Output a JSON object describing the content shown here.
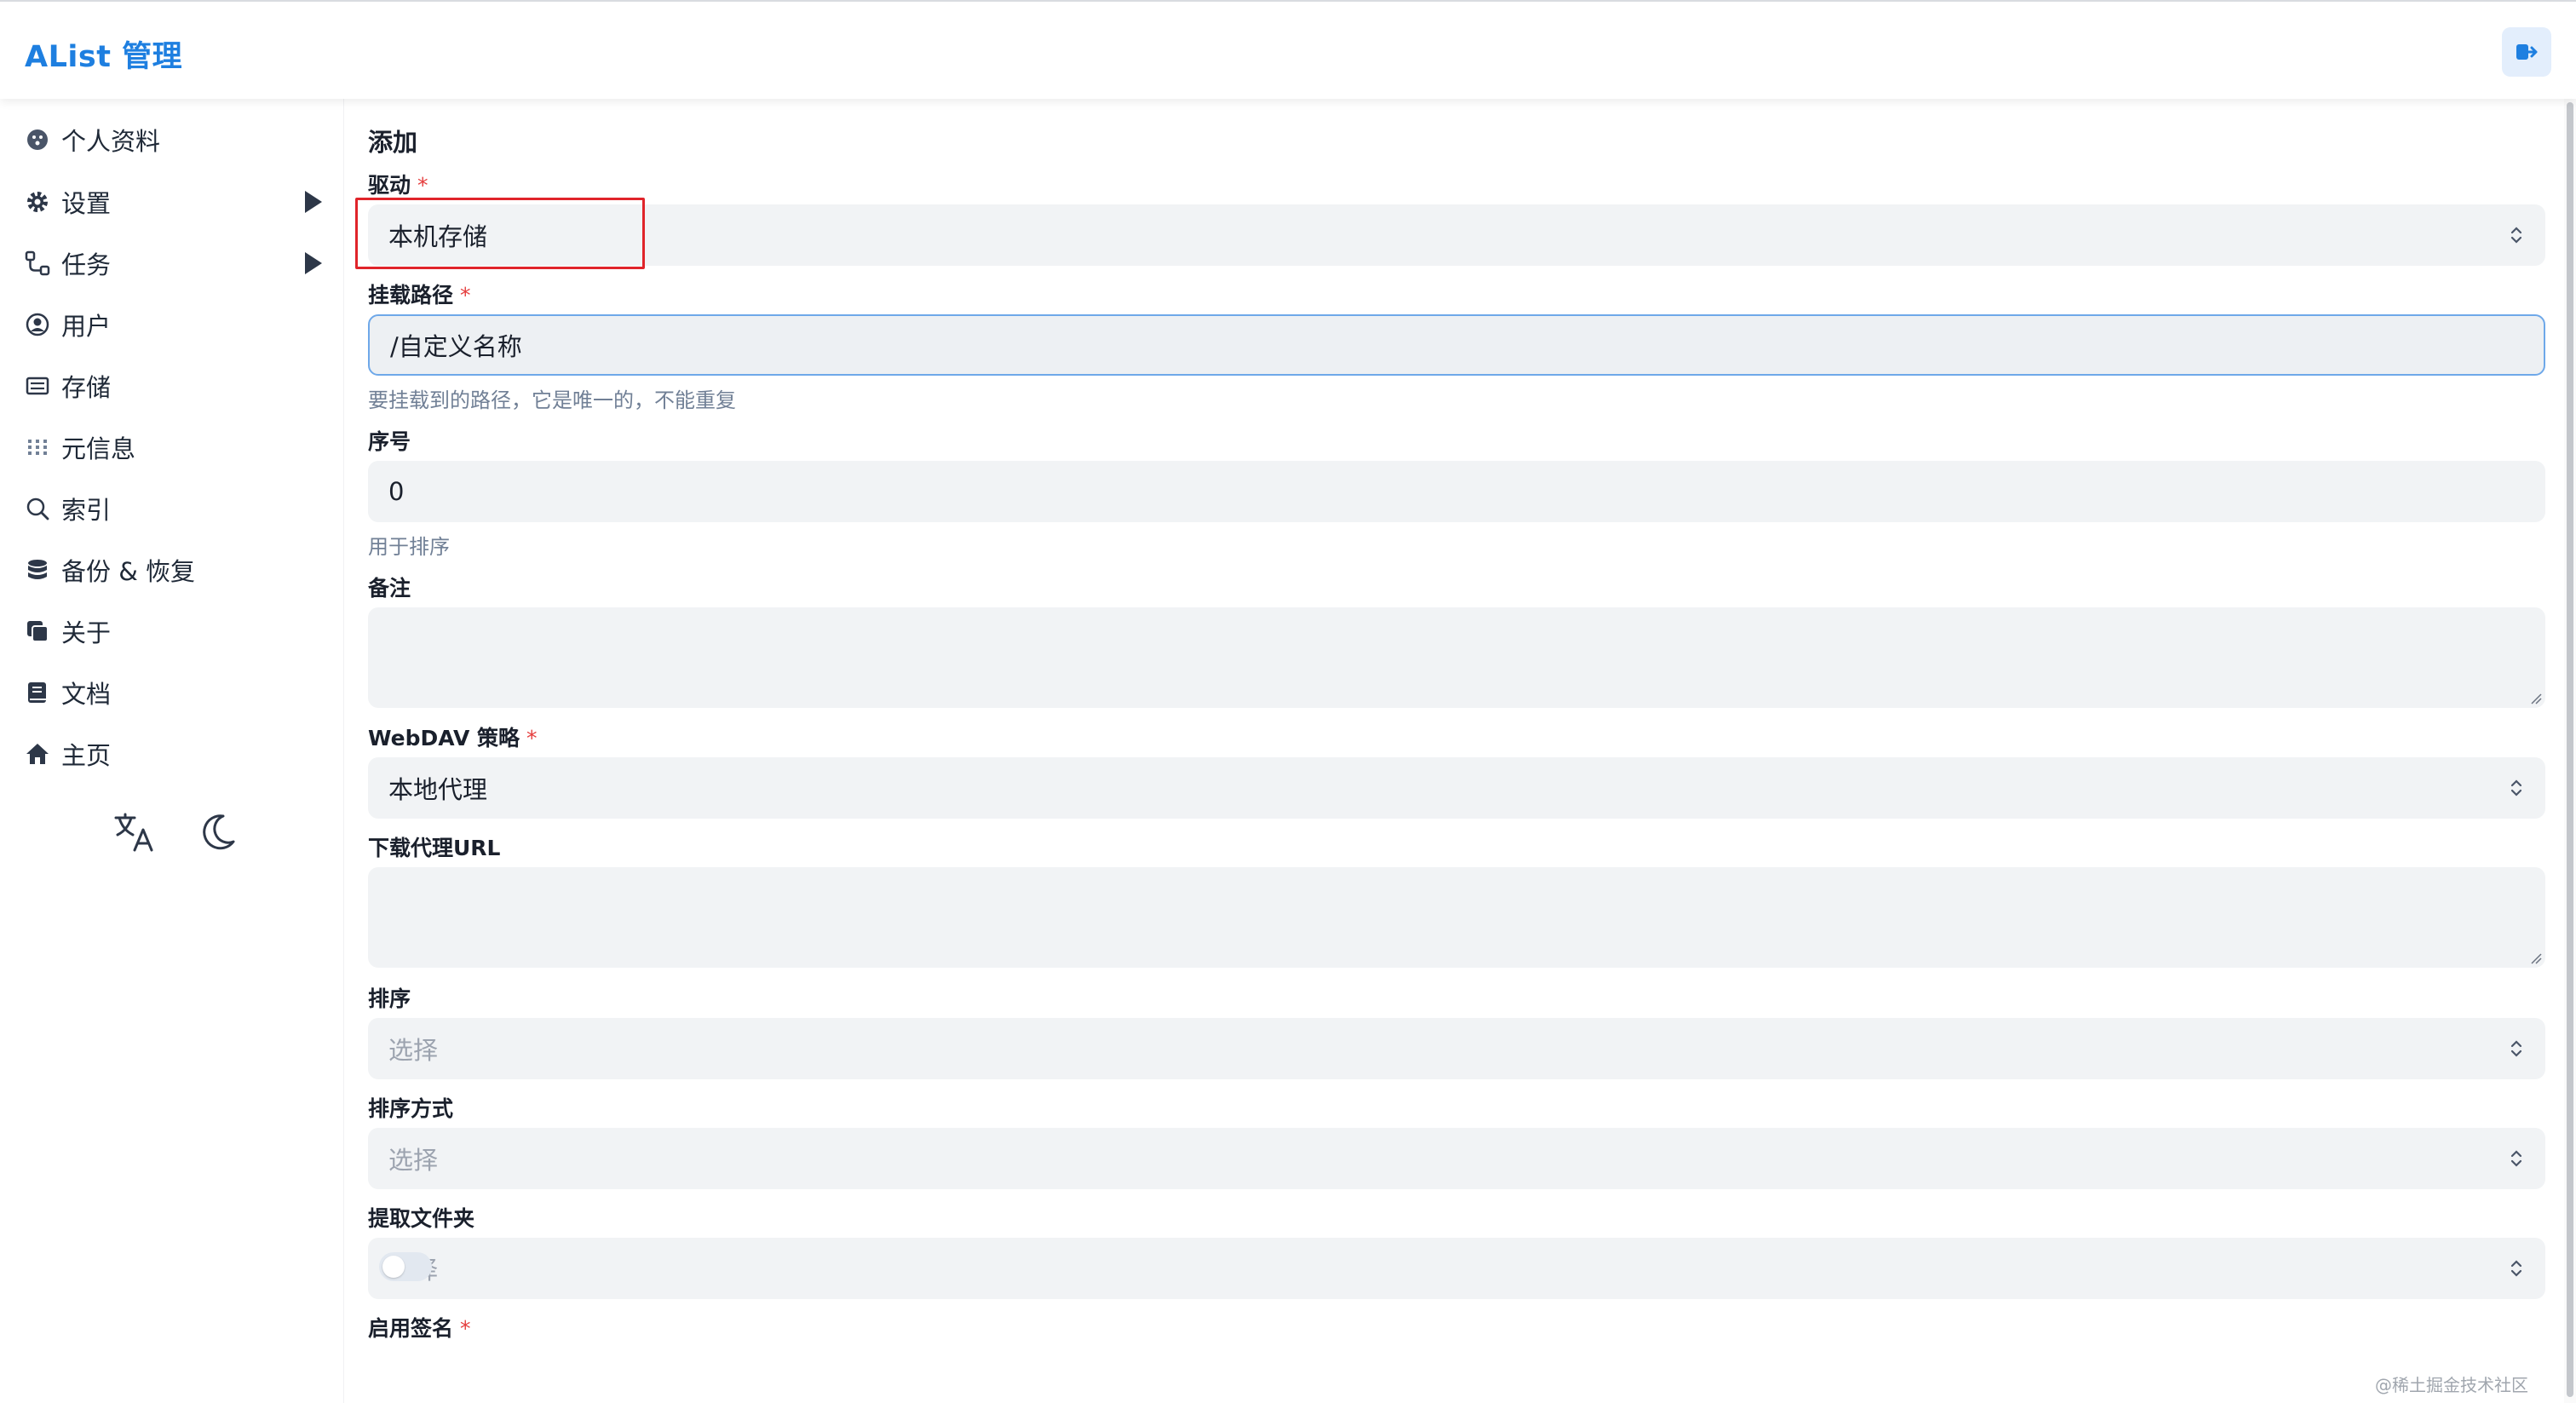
{
  "header": {
    "title": "AList 管理",
    "logout_icon": "logout-icon"
  },
  "sidebar": {
    "items": [
      {
        "label": "个人资料",
        "icon": "profile-icon"
      },
      {
        "label": "设置",
        "icon": "gear-icon",
        "expandable": true
      },
      {
        "label": "任务",
        "icon": "tasks-icon",
        "expandable": true
      },
      {
        "label": "用户",
        "icon": "user-icon"
      },
      {
        "label": "存储",
        "icon": "storage-icon"
      },
      {
        "label": "元信息",
        "icon": "meta-icon"
      },
      {
        "label": "索引",
        "icon": "search-icon"
      },
      {
        "label": "备份 & 恢复",
        "icon": "database-icon"
      },
      {
        "label": "关于",
        "icon": "about-icon"
      },
      {
        "label": "文档",
        "icon": "book-icon"
      },
      {
        "label": "主页",
        "icon": "home-icon"
      }
    ],
    "bottom": {
      "language_icon": "language-icon",
      "theme_icon": "moon-icon"
    }
  },
  "form": {
    "title": "添加",
    "driver": {
      "label": "驱动",
      "value": "本机存储"
    },
    "mount_path": {
      "label": "挂载路径",
      "value": "/自定义名称",
      "helper": "要挂载到的路径，它是唯一的，不能重复"
    },
    "order": {
      "label": "序号",
      "value": "0",
      "helper": "用于排序"
    },
    "remark": {
      "label": "备注",
      "value": ""
    },
    "webdav_policy": {
      "label": "WebDAV 策略",
      "value": "本地代理"
    },
    "download_proxy_url": {
      "label": "下载代理URL",
      "value": ""
    },
    "sort": {
      "label": "排序",
      "placeholder": "选择"
    },
    "sort_direction": {
      "label": "排序方式",
      "placeholder": "选择"
    },
    "extract_folder": {
      "label": "提取文件夹",
      "placeholder": "选择"
    },
    "enable_sign": {
      "label": "启用签名",
      "value": false
    },
    "required_mark": "*"
  },
  "watermark": "@稀土掘金技术社区",
  "colors": {
    "accent": "#1e7fe0",
    "required": "#e53e3e",
    "highlight": "#e0242a"
  }
}
